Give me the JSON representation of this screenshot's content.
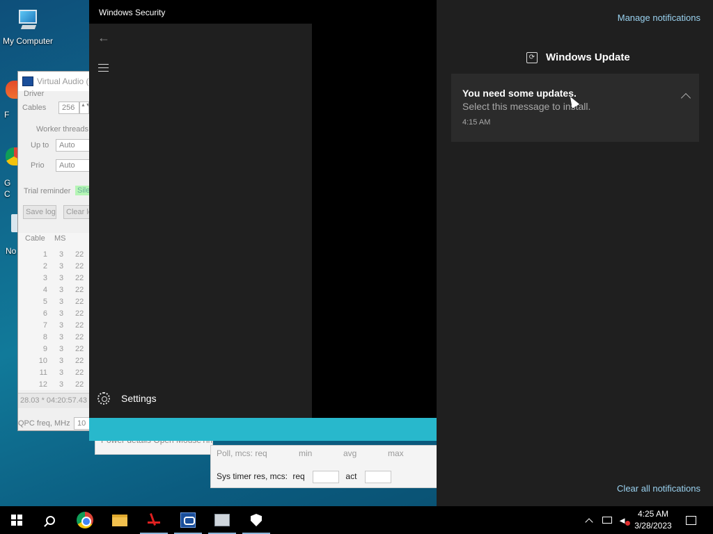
{
  "desktop": {
    "icons": [
      {
        "label": "My Computer"
      },
      {
        "label": "F"
      },
      {
        "label": "G"
      },
      {
        "label": "C"
      },
      {
        "label": "No"
      }
    ]
  },
  "vac_window": {
    "title": "Virtual Audio (",
    "driver_label": "Driver",
    "cables_label": "Cables",
    "cables_value": "256",
    "worker_threads_label": "Worker threads",
    "up_to_label": "Up to",
    "up_to_value": "Auto",
    "prio_label": "Prio",
    "prio_value": "Auto",
    "trial_reminder_label": "Trial reminder",
    "trial_reminder_value": "Sile",
    "save_log_label": "Save log",
    "clear_log_label": "Clear lo",
    "table": {
      "headers": [
        "Cable",
        "MS"
      ],
      "rows": [
        [
          "1",
          "3",
          "22"
        ],
        [
          "2",
          "3",
          "22"
        ],
        [
          "3",
          "3",
          "22"
        ],
        [
          "4",
          "3",
          "22"
        ],
        [
          "5",
          "3",
          "22"
        ],
        [
          "6",
          "3",
          "22"
        ],
        [
          "7",
          "3",
          "22"
        ],
        [
          "8",
          "3",
          "22"
        ],
        [
          "9",
          "3",
          "22"
        ],
        [
          "10",
          "3",
          "22"
        ],
        [
          "11",
          "3",
          "22"
        ],
        [
          "12",
          "3",
          "22"
        ]
      ]
    },
    "status_line": "28.03 * 04:20:57.43",
    "qpc_label": "QPC freq, MHz",
    "qpc_value": "10"
  },
  "latency_window": {
    "top_buttons": "Power details    Open MouseTimer",
    "row1": {
      "label": "Poll, mcs: req",
      "min": "min",
      "avg": "avg",
      "max": "max"
    },
    "sys_timer_label": "Sys timer res, mcs:",
    "req_label": "req",
    "act_label": "act"
  },
  "windows_security": {
    "title": "Windows Security",
    "back_icon": "back-arrow-icon",
    "menu_icon": "hamburger-menu-icon",
    "settings_label": "Settings"
  },
  "action_center": {
    "manage_label": "Manage notifications",
    "group_title": "Windows Update",
    "notification": {
      "title": "You need some updates.",
      "body": "Select this message to install.",
      "time": "4:15 AM"
    },
    "clear_all_label": "Clear all notifications"
  },
  "taskbar": {
    "items": [
      "start",
      "search",
      "chrome",
      "file-explorer",
      "app-red",
      "virtual-audio-cable",
      "my-computer",
      "windows-security"
    ],
    "clock_time": "4:25 AM",
    "clock_date": "3/28/2023"
  },
  "colors": {
    "accent_bar": "#28b8cc",
    "link": "#9ad2f0",
    "action_center_bg": "#1f1f1f"
  }
}
